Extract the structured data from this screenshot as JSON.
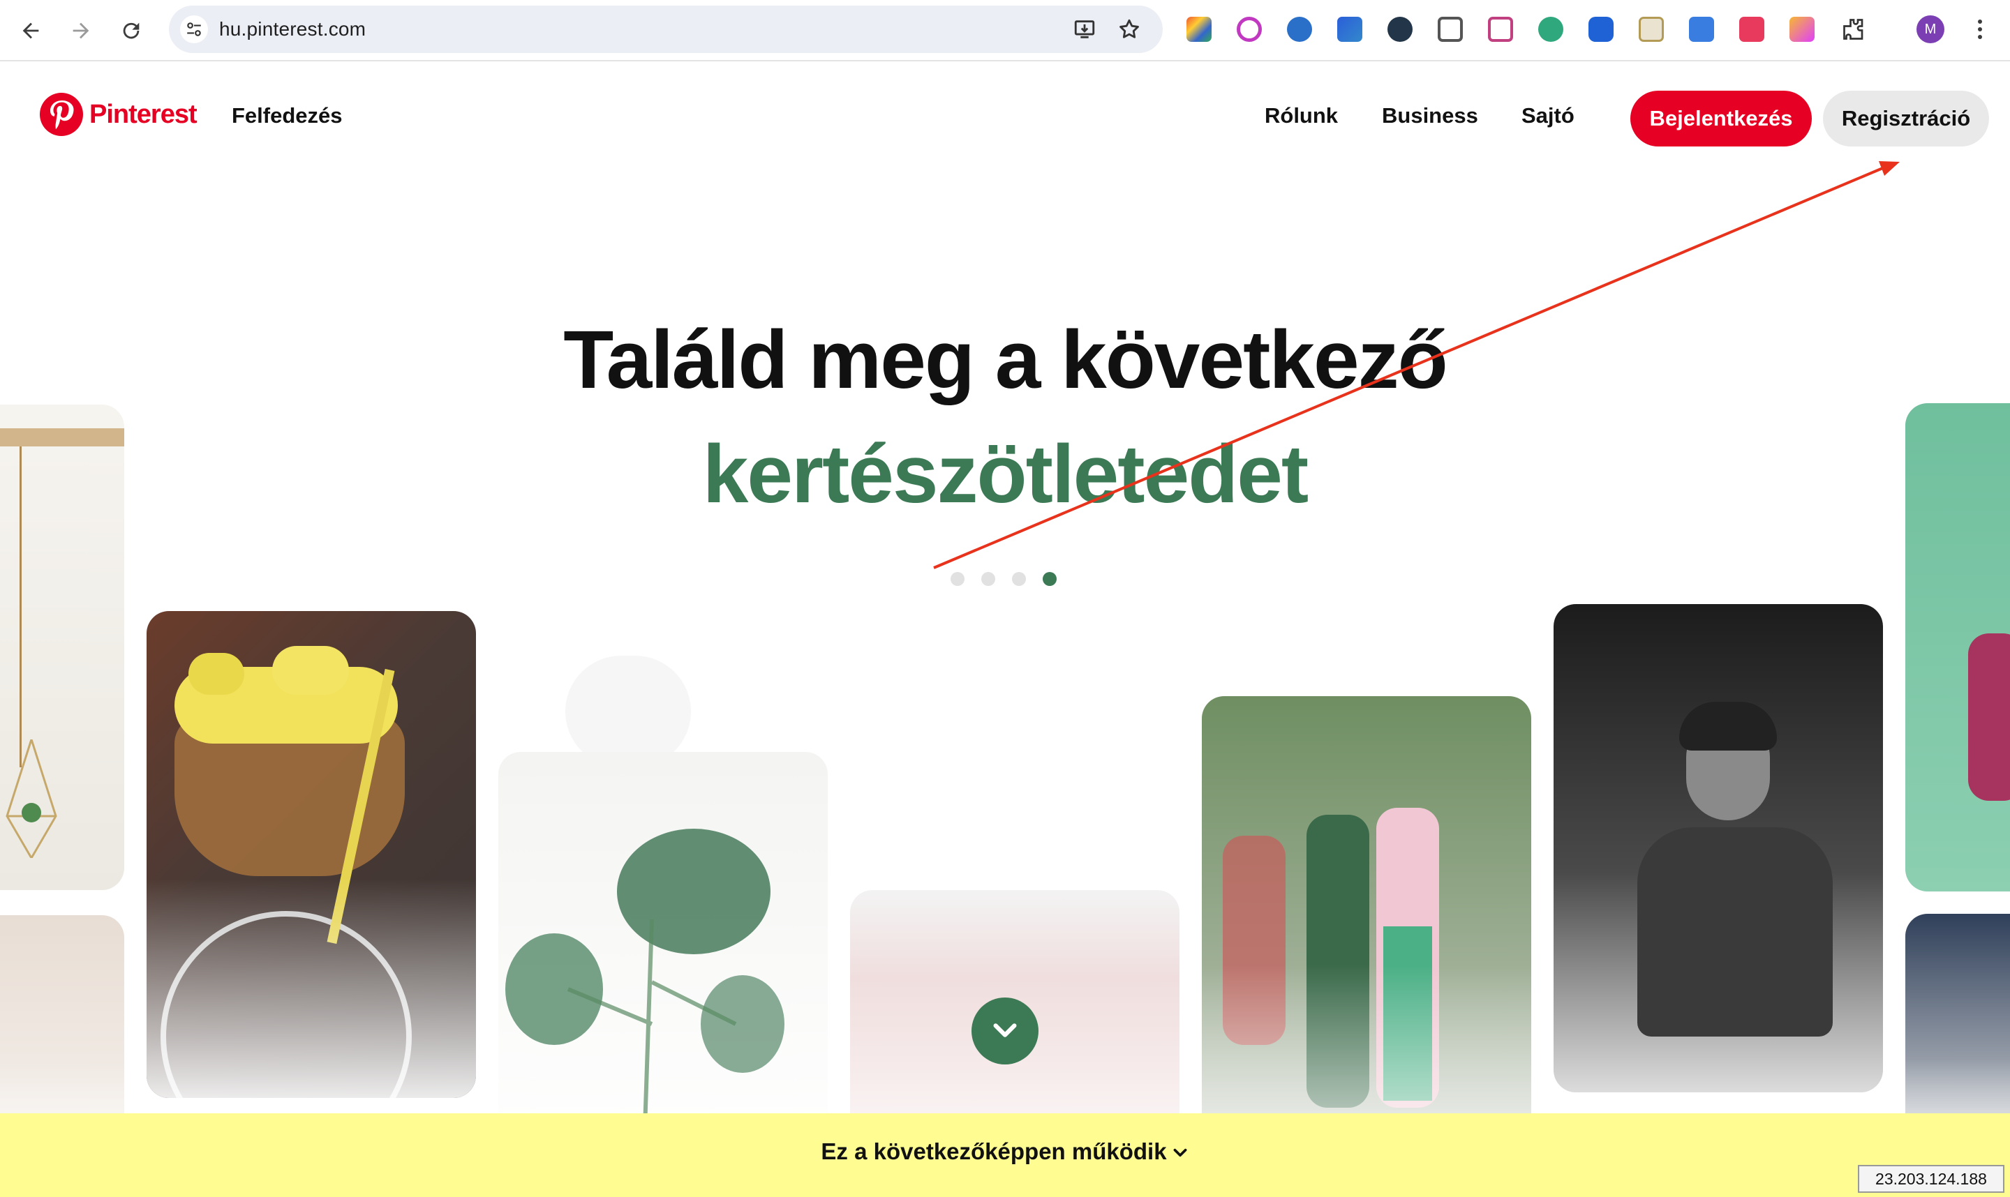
{
  "browser": {
    "url": "hu.pinterest.com",
    "profile_initial": "M",
    "extensions": [
      "ext-1",
      "ext-2",
      "ext-3",
      "ext-4",
      "ext-5",
      "ext-6",
      "ext-7",
      "ext-8",
      "ext-9",
      "ext-10",
      "ext-11",
      "ext-12",
      "ext-13"
    ],
    "icons": [
      "back-icon",
      "forward-icon",
      "reload-icon",
      "site-settings-icon",
      "install-icon",
      "bookmark-star-icon",
      "puzzle-extensions-icon",
      "more-menu-icon"
    ]
  },
  "header": {
    "brand": "Pinterest",
    "explore": "Felfedezés",
    "about": "Rólunk",
    "business": "Business",
    "press": "Sajtó",
    "login": "Bejelentkezés",
    "signup": "Regisztráció",
    "brand_color": "#e60023"
  },
  "hero": {
    "line1": "Találd meg a következő",
    "line2": "kertészötletedet",
    "accent_color": "#3c7a55",
    "carousel_total": 4,
    "carousel_active": 4
  },
  "banner": {
    "label": "Ez a következőképpen működik",
    "background": "#fffd92"
  },
  "overlay": {
    "ip": "23.203.124.188",
    "annotation_color": "#e8321c"
  }
}
